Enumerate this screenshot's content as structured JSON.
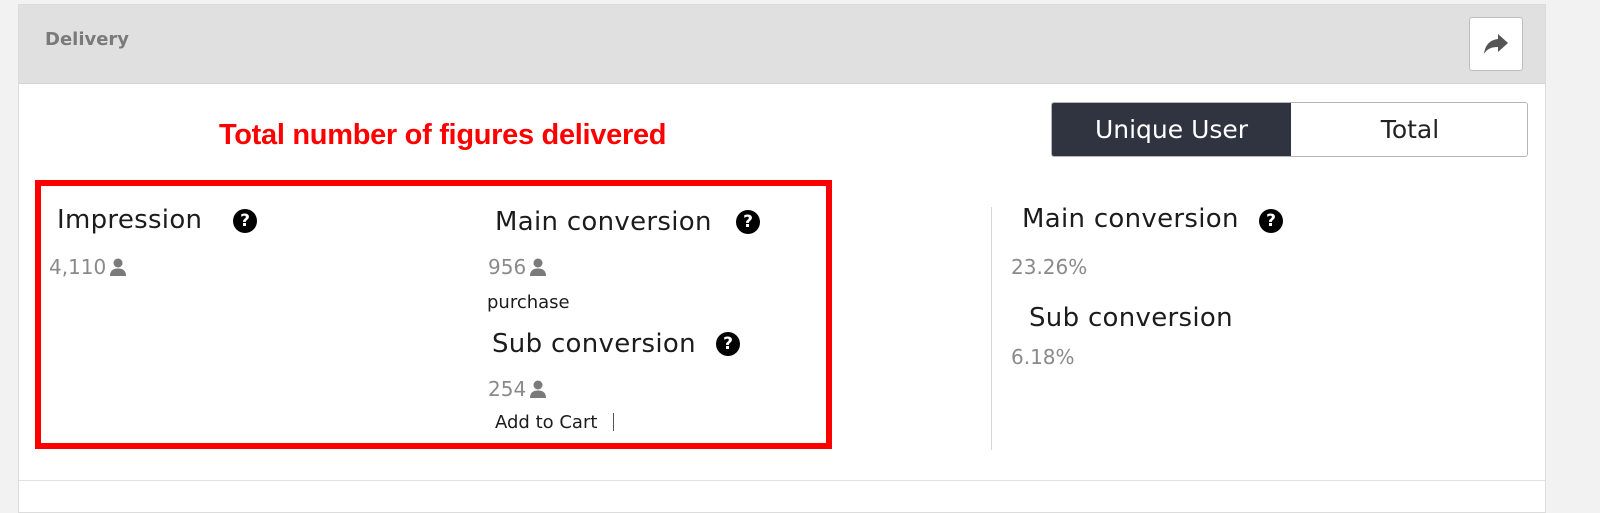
{
  "header": {
    "title": "Delivery",
    "share_icon": "share-arrow-icon"
  },
  "annotation": {
    "text": "Total number of figures delivered",
    "color": "#ff0000"
  },
  "toggle": {
    "options": [
      {
        "label": "Unique User",
        "active": true
      },
      {
        "label": "Total",
        "active": false
      }
    ]
  },
  "metrics": {
    "impression": {
      "label": "Impression",
      "value": "4,110",
      "help": "?"
    },
    "main_conversion": {
      "label": "Main conversion",
      "value": "956",
      "event": "purchase",
      "help": "?"
    },
    "sub_conversion": {
      "label": "Sub conversion",
      "value": "254",
      "event": "Add to Cart",
      "help": "?"
    }
  },
  "rates": {
    "main_conversion": {
      "label": "Main conversion",
      "value": "23.26%",
      "help": "?"
    },
    "sub_conversion": {
      "label": "Sub conversion",
      "value": "6.18%"
    }
  },
  "colors": {
    "accent": "#2f3440",
    "highlight": "#ff0000",
    "header_bg": "#e0e0e0"
  }
}
